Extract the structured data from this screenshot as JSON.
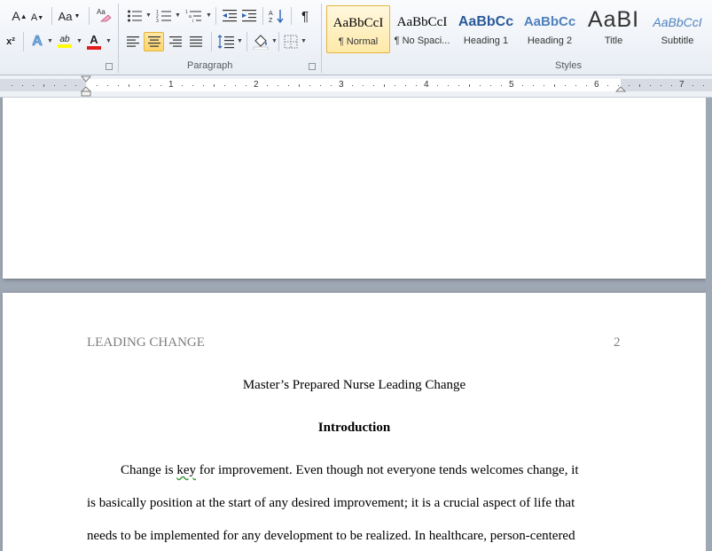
{
  "ribbon": {
    "font_group": {
      "grow_font": "A",
      "shrink_font": "A",
      "change_case": "Aa",
      "superscript": "x²",
      "text_effects_letter": "A",
      "highlight_letters": "ab",
      "font_color_letter": "A"
    },
    "paragraph_group": {
      "label": "Paragraph",
      "pilcrow": "¶"
    },
    "styles_group": {
      "label": "Styles",
      "items": [
        {
          "sample": "AaBbCcI",
          "name": "¶ Normal"
        },
        {
          "sample": "AaBbCcI",
          "name": "¶ No Spaci..."
        },
        {
          "sample": "AaBbCc",
          "name": "Heading 1"
        },
        {
          "sample": "AaBbCc",
          "name": "Heading 2"
        },
        {
          "sample": "AaBI",
          "name": "Title"
        },
        {
          "sample": "AaBbCcI",
          "name": "Subtitle"
        }
      ]
    }
  },
  "ruler": {
    "numbers": [
      "1",
      "2",
      "3",
      "4",
      "5",
      "6",
      "7"
    ]
  },
  "document": {
    "header_left": "LEADING CHANGE",
    "header_page_number": "2",
    "title": "Master’s Prepared Nurse Leading Change",
    "heading": "Introduction",
    "para_line1_before": "Change is ",
    "para_line1_flagged": "key",
    "para_line1_after": " for improvement.  Even though not everyone tends welcomes change, it",
    "para_line2": "is basically position at the start of any desired improvement; it is a crucial aspect of life that",
    "para_line3": "needs to be implemented for any development to be realized. In healthcare, person-centered"
  },
  "colors": {
    "ribbon_bg": "#e8edf4",
    "doc_bg": "#9ea7b4",
    "selected_style": "#ffe9a8",
    "heading_blue": "#2a5a9a",
    "header_gray": "#7f7f7f"
  }
}
